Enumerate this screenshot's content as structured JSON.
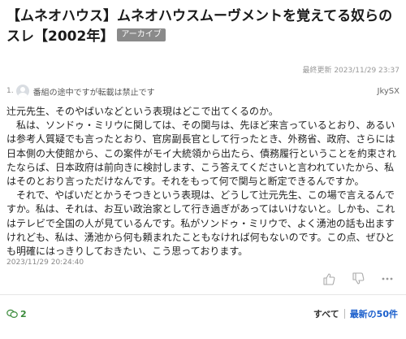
{
  "thread": {
    "title": "【ムネオハウス】ムネオハウスムーヴメントを覚えてる奴らのスレ【2002年】",
    "badge": "アーカイブ",
    "last_updated": "最終更新 2023/11/29 23:37"
  },
  "post": {
    "number": "1.",
    "name": "番組の途中ですが転載は禁止です",
    "id": "JkySX",
    "paragraphs": [
      "辻元先生、そのやばいなどという表現はどこで出てくるのか。",
      "　私は、ソンドゥ・ミリウに関しては、その関与は、先ほど来言っているとおり、あるいは参考人質疑でも言ったとおり、官房副長官として行ったとき、外務省、政府、さらには日本側の大使館から、この案件がモイ大統領から出たら、債務履行ということを約束されたならば、日本政府は前向きに検討します、こう答えてくださいと言われていたから、私はそのとおり言っただけなんです。それをもって何で関与と断定できるんですか。",
      "　それで、やばいだとかうそつきという表現は、どうして辻元先生、この場で言えるんですか。私は、それは、お互い政治家として行き過ぎがあってはいけないと。しかも、これはテレビで全国の人が見ているんです。私がソンドゥ・ミリウで、よく湧池の話も出ますけれども、私は、湧池から何も頼まれたこともなければ何もないのです。この点、ぜひとも明確にはっきりしておきたい、こう思っております。"
    ],
    "date": "2023/11/29 20:24:40"
  },
  "reactions": {
    "like_icon": "thumbs-up-icon",
    "dislike_icon": "thumbs-down-icon",
    "more_icon": "more-icon"
  },
  "footer": {
    "comment_count": "2",
    "all_label": "すべて",
    "latest_label": "最新の50件"
  },
  "colors": {
    "badge_bg": "#8a8a8a",
    "comment_green": "#3a8a3a",
    "link_blue": "#1b5fcc"
  }
}
